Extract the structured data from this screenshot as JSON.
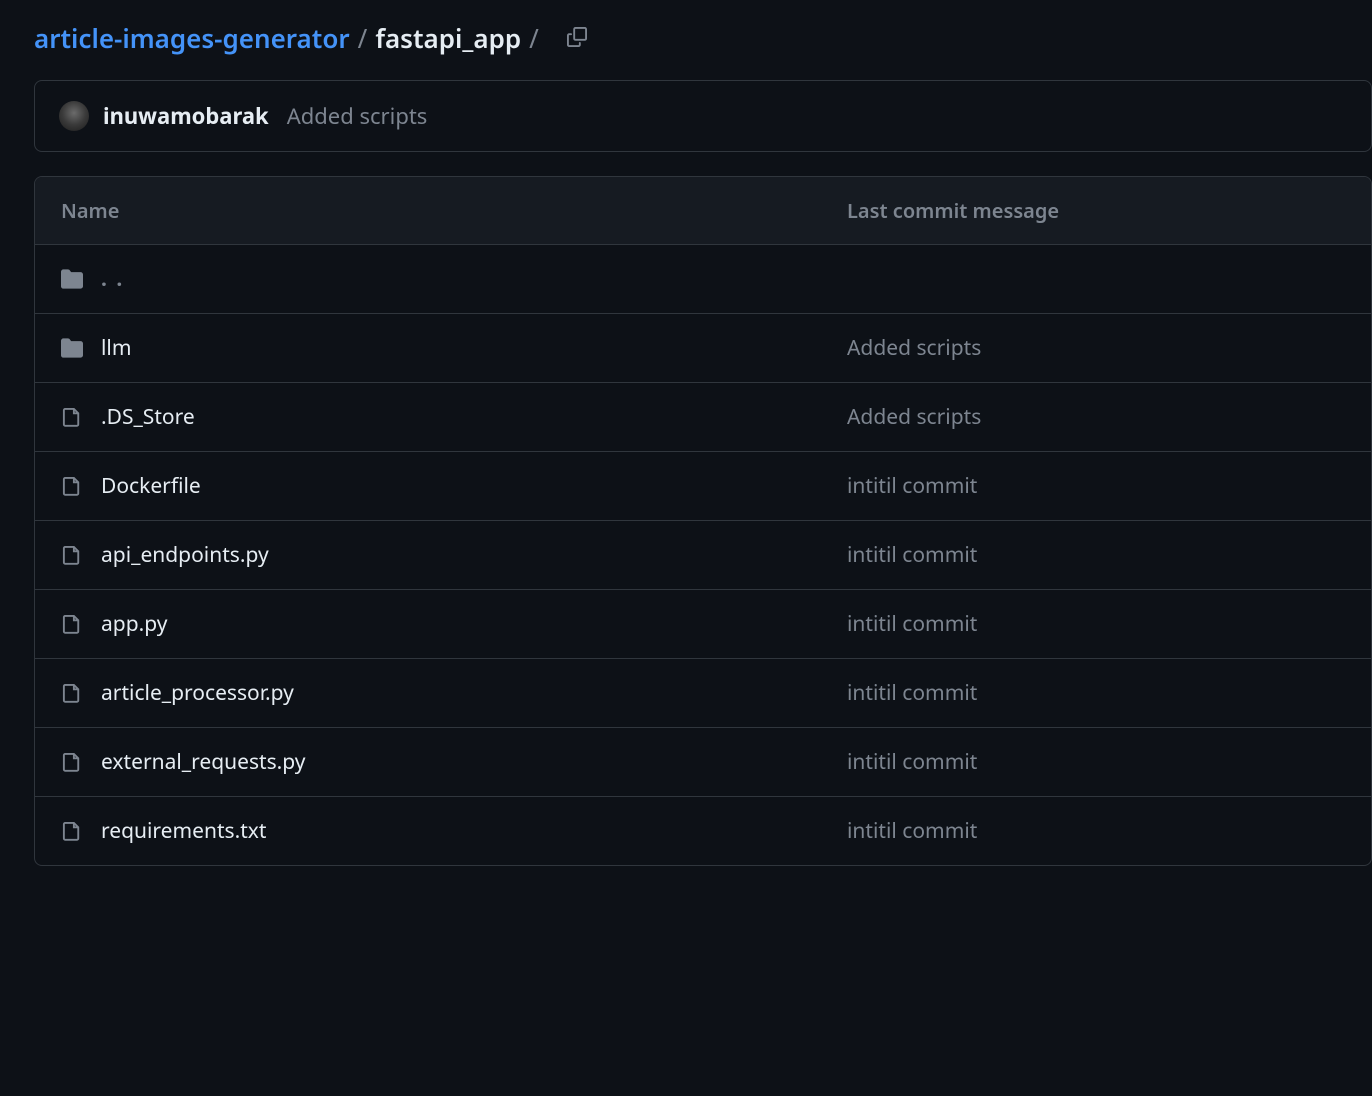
{
  "breadcrumb": {
    "repo": "article-images-generator",
    "current": "fastapi_app",
    "sep": "/"
  },
  "commit": {
    "author": "inuwamobarak",
    "message": "Added scripts"
  },
  "table": {
    "headers": {
      "name": "Name",
      "commit": "Last commit message"
    },
    "parent": ". .",
    "rows": [
      {
        "type": "folder",
        "name": "llm",
        "commit": "Added scripts"
      },
      {
        "type": "file",
        "name": ".DS_Store",
        "commit": "Added scripts"
      },
      {
        "type": "file",
        "name": "Dockerfile",
        "commit": "intitil commit"
      },
      {
        "type": "file",
        "name": "api_endpoints.py",
        "commit": "intitil commit"
      },
      {
        "type": "file",
        "name": "app.py",
        "commit": "intitil commit"
      },
      {
        "type": "file",
        "name": "article_processor.py",
        "commit": "intitil commit"
      },
      {
        "type": "file",
        "name": "external_requests.py",
        "commit": "intitil commit"
      },
      {
        "type": "file",
        "name": "requirements.txt",
        "commit": "intitil commit"
      }
    ]
  }
}
